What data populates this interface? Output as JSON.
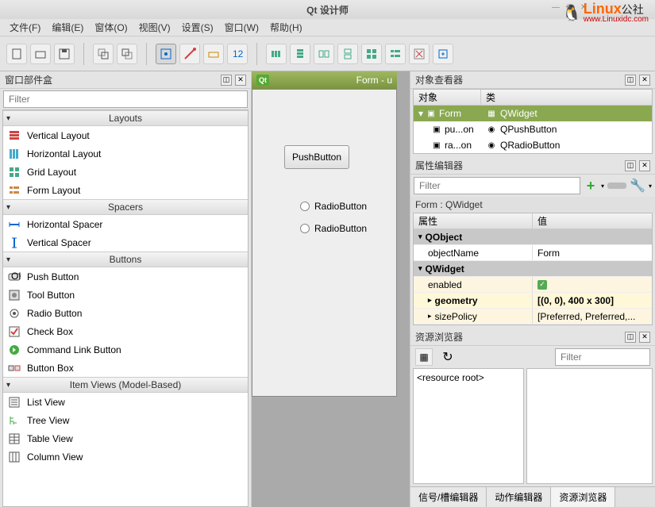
{
  "title": "Qt 设计师",
  "watermark": {
    "logo_text": "Linux",
    "suffix": "公社",
    "url": "www.Linuxidc.com"
  },
  "menu": [
    "文件(F)",
    "编辑(E)",
    "窗体(O)",
    "视图(V)",
    "设置(S)",
    "窗口(W)",
    "帮助(H)"
  ],
  "widget_box": {
    "title": "窗口部件盒",
    "filter_placeholder": "Filter",
    "categories": [
      {
        "name": "Layouts",
        "items": [
          {
            "icon": "layout-v",
            "label": "Vertical Layout"
          },
          {
            "icon": "layout-h",
            "label": "Horizontal Layout"
          },
          {
            "icon": "grid",
            "label": "Grid Layout"
          },
          {
            "icon": "form",
            "label": "Form Layout"
          }
        ]
      },
      {
        "name": "Spacers",
        "items": [
          {
            "icon": "spacer-h",
            "label": "Horizontal Spacer"
          },
          {
            "icon": "spacer-v",
            "label": "Vertical Spacer"
          }
        ]
      },
      {
        "name": "Buttons",
        "items": [
          {
            "icon": "push",
            "label": "Push Button"
          },
          {
            "icon": "tool",
            "label": "Tool Button"
          },
          {
            "icon": "radio",
            "label": "Radio Button"
          },
          {
            "icon": "check",
            "label": "Check Box"
          },
          {
            "icon": "command",
            "label": "Command Link Button"
          },
          {
            "icon": "buttonbox",
            "label": "Button Box"
          }
        ]
      },
      {
        "name": "Item Views (Model-Based)",
        "items": [
          {
            "icon": "list",
            "label": "List View"
          },
          {
            "icon": "tree",
            "label": "Tree View"
          },
          {
            "icon": "table",
            "label": "Table View"
          },
          {
            "icon": "column",
            "label": "Column View"
          }
        ]
      }
    ]
  },
  "form": {
    "title": "Form - u",
    "push_button": "PushButton",
    "radio1": "RadioButton",
    "radio2": "RadioButton"
  },
  "object_inspector": {
    "title": "对象查看器",
    "headers": [
      "对象",
      "类"
    ],
    "rows": [
      {
        "name": "Form",
        "class": "QWidget",
        "selected": true,
        "indent": 0
      },
      {
        "name": "pu...on",
        "class": "QPushButton",
        "indent": 1
      },
      {
        "name": "ra...on",
        "class": "QRadioButton",
        "indent": 1
      }
    ]
  },
  "property_editor": {
    "title": "属性编辑器",
    "filter_placeholder": "Filter",
    "subtitle": "Form : QWidget",
    "headers": [
      "属性",
      "值"
    ],
    "groups": [
      {
        "section": "QObject",
        "props": [
          {
            "name": "objectName",
            "value": "Form"
          }
        ]
      },
      {
        "section": "QWidget",
        "props": [
          {
            "name": "enabled",
            "value": "check",
            "alt": true
          },
          {
            "name": "geometry",
            "value": "[(0, 0), 400 x 300]",
            "hl": true,
            "arrow": true
          },
          {
            "name": "sizePolicy",
            "value": "[Preferred, Preferred,...",
            "arrow": true,
            "alt": true
          }
        ]
      }
    ]
  },
  "resource_browser": {
    "title": "资源浏览器",
    "root": "<resource root>",
    "filter_placeholder": "Filter"
  },
  "tabs": [
    "信号/槽编辑器",
    "动作编辑器",
    "资源浏览器"
  ]
}
